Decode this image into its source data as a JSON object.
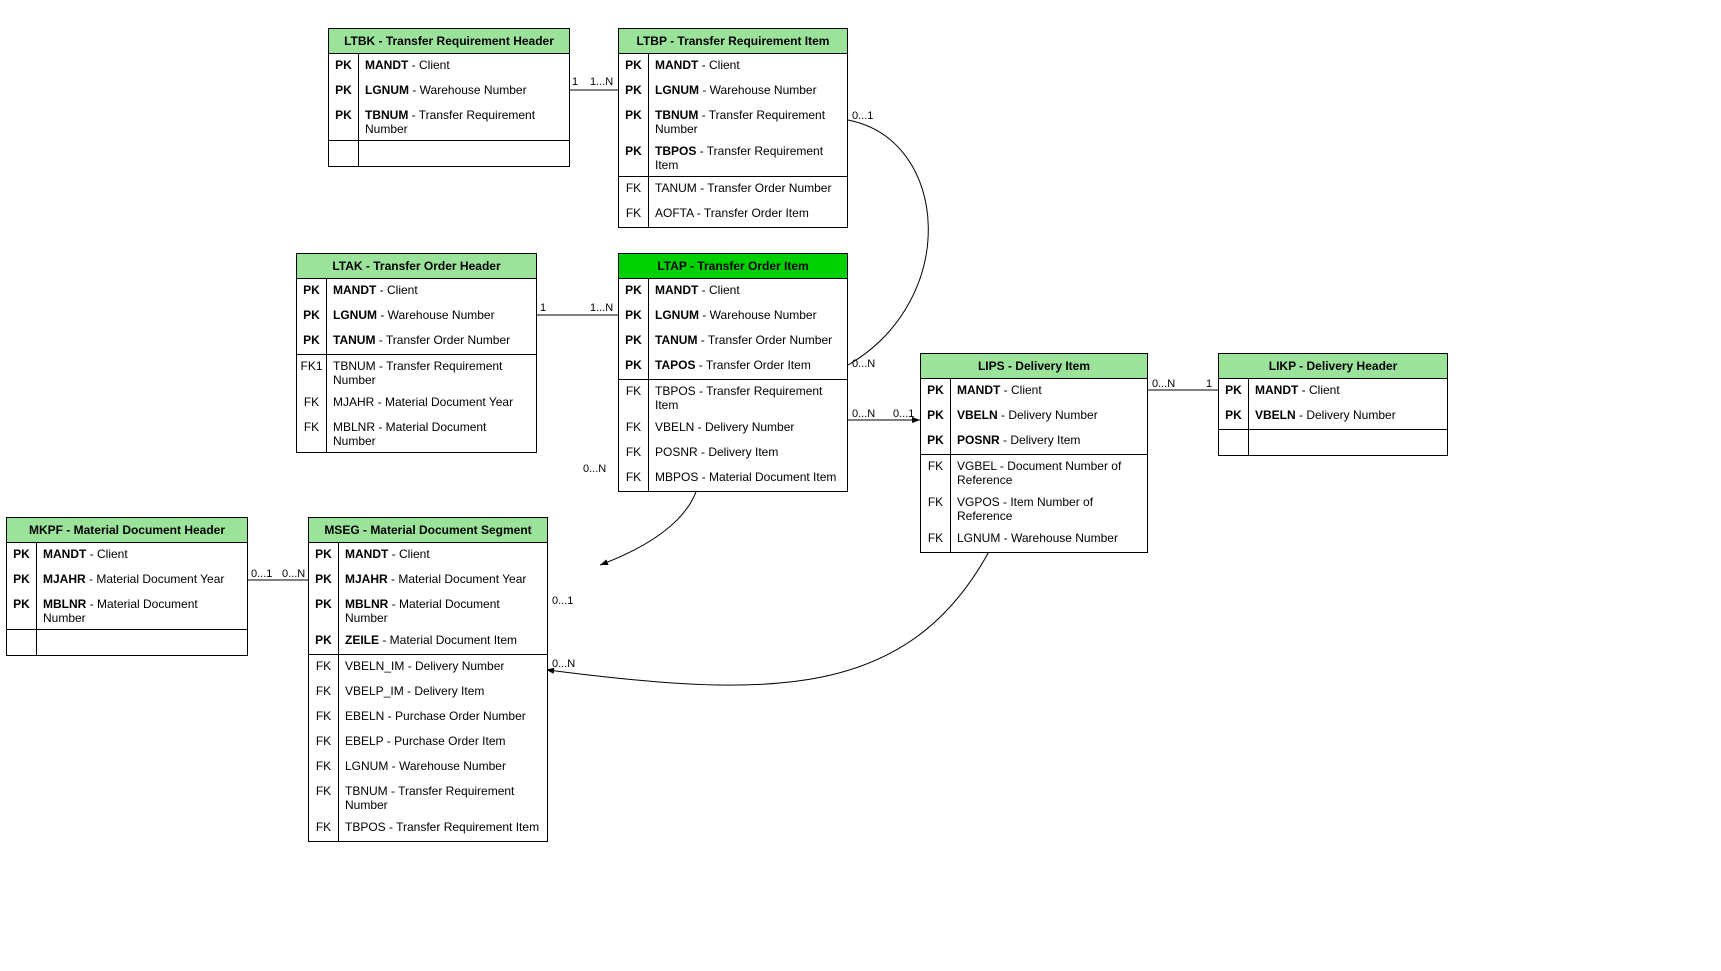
{
  "entities": {
    "ltbk": {
      "title": "LTBK - Transfer Requirement Header",
      "rows": [
        {
          "key": "PK",
          "name": "MANDT",
          "desc": "Client"
        },
        {
          "key": "PK",
          "name": "LGNUM",
          "desc": "Warehouse Number"
        },
        {
          "key": "PK",
          "name": "TBNUM",
          "desc": "Transfer Requirement Number"
        }
      ]
    },
    "ltbp": {
      "title": "LTBP - Transfer Requirement Item",
      "rows_pk": [
        {
          "key": "PK",
          "name": "MANDT",
          "desc": "Client"
        },
        {
          "key": "PK",
          "name": "LGNUM",
          "desc": "Warehouse Number"
        },
        {
          "key": "PK",
          "name": "TBNUM",
          "desc": "Transfer Requirement Number"
        },
        {
          "key": "PK",
          "name": "TBPOS",
          "desc": "Transfer Requirement Item"
        }
      ],
      "rows_fk": [
        {
          "key": "FK",
          "name": "TANUM",
          "desc": "Transfer Order Number"
        },
        {
          "key": "FK",
          "name": "AOFTA",
          "desc": "Transfer Order Item"
        }
      ]
    },
    "ltak": {
      "title": "LTAK - Transfer Order Header",
      "rows_pk": [
        {
          "key": "PK",
          "name": "MANDT",
          "desc": "Client"
        },
        {
          "key": "PK",
          "name": "LGNUM",
          "desc": "Warehouse Number"
        },
        {
          "key": "PK",
          "name": "TANUM",
          "desc": "Transfer Order Number"
        }
      ],
      "rows_fk": [
        {
          "key": "FK1",
          "name": "TBNUM",
          "desc": "Transfer Requirement Number"
        },
        {
          "key": "FK",
          "name": "MJAHR",
          "desc": "Material Document Year"
        },
        {
          "key": "FK",
          "name": "MBLNR",
          "desc": "Material Document Number"
        }
      ]
    },
    "ltap": {
      "title": "LTAP - Transfer Order Item",
      "rows_pk": [
        {
          "key": "PK",
          "name": "MANDT",
          "desc": "Client"
        },
        {
          "key": "PK",
          "name": "LGNUM",
          "desc": "Warehouse Number"
        },
        {
          "key": "PK",
          "name": "TANUM",
          "desc": "Transfer Order Number"
        },
        {
          "key": "PK",
          "name": "TAPOS",
          "desc": "Transfer Order Item"
        }
      ],
      "rows_fk": [
        {
          "key": "FK",
          "name": "TBPOS",
          "desc": "Transfer Requirement Item"
        },
        {
          "key": "FK",
          "name": "VBELN",
          "desc": "Delivery Number"
        },
        {
          "key": "FK",
          "name": "POSNR",
          "desc": "Delivery Item"
        },
        {
          "key": "FK",
          "name": "MBPOS",
          "desc": "Material Document Item"
        }
      ]
    },
    "lips": {
      "title": "LIPS - Delivery Item",
      "rows_pk": [
        {
          "key": "PK",
          "name": "MANDT",
          "desc": "Client"
        },
        {
          "key": "PK",
          "name": "VBELN",
          "desc": "Delivery Number"
        },
        {
          "key": "PK",
          "name": "POSNR",
          "desc": "Delivery Item"
        }
      ],
      "rows_fk": [
        {
          "key": "FK",
          "name": "VGBEL",
          "desc": "Document Number of Reference"
        },
        {
          "key": "FK",
          "name": "VGPOS",
          "desc": "Item Number of Reference"
        },
        {
          "key": "FK",
          "name": "LGNUM",
          "desc": "Warehouse Number"
        }
      ]
    },
    "likp": {
      "title": "LIKP - Delivery Header",
      "rows_pk": [
        {
          "key": "PK",
          "name": "MANDT",
          "desc": "Client"
        },
        {
          "key": "PK",
          "name": "VBELN",
          "desc": "Delivery Number"
        }
      ]
    },
    "mkpf": {
      "title": "MKPF - Material Document Header",
      "rows_pk": [
        {
          "key": "PK",
          "name": "MANDT",
          "desc": "Client"
        },
        {
          "key": "PK",
          "name": "MJAHR",
          "desc": "Material Document Year"
        },
        {
          "key": "PK",
          "name": "MBLNR",
          "desc": "Material Document Number"
        }
      ]
    },
    "mseg": {
      "title": "MSEG - Material Document Segment",
      "rows_pk": [
        {
          "key": "PK",
          "name": "MANDT",
          "desc": "Client"
        },
        {
          "key": "PK",
          "name": "MJAHR",
          "desc": "Material Document Year"
        },
        {
          "key": "PK",
          "name": "MBLNR",
          "desc": "Material Document Number"
        },
        {
          "key": "PK",
          "name": "ZEILE",
          "desc": "Material Document Item"
        }
      ],
      "rows_fk": [
        {
          "key": "FK",
          "name": "VBELN_IM",
          "desc": "Delivery Number"
        },
        {
          "key": "FK",
          "name": "VBELP_IM",
          "desc": "Delivery Item"
        },
        {
          "key": "FK",
          "name": "EBELN",
          "desc": "Purchase Order Number"
        },
        {
          "key": "FK",
          "name": "EBELP",
          "desc": "Purchase Order Item"
        },
        {
          "key": "FK",
          "name": "LGNUM",
          "desc": "Warehouse Number"
        },
        {
          "key": "FK",
          "name": "TBNUM",
          "desc": "Transfer Requirement Number"
        },
        {
          "key": "FK",
          "name": "TBPOS",
          "desc": "Transfer Requirement Item"
        }
      ]
    }
  },
  "cardinalities": {
    "ltbk_ltbp_left": "1",
    "ltbk_ltbp_right": "1...N",
    "ltak_ltap_left": "1",
    "ltak_ltap_right": "1...N",
    "ltbp_ltap_top": "0...1",
    "ltbp_ltap_bottom": "0...N",
    "ltap_lips_left": "0...N",
    "ltap_lips_right": "0...1",
    "lips_likp_left": "0...N",
    "lips_likp_right": "1",
    "mkpf_mseg_left": "0...1",
    "mkpf_mseg_right": "0...N",
    "ltap_mseg_top": "0...N",
    "ltap_mseg_bottom": "0...1",
    "mseg_lips_left": "0...N"
  }
}
